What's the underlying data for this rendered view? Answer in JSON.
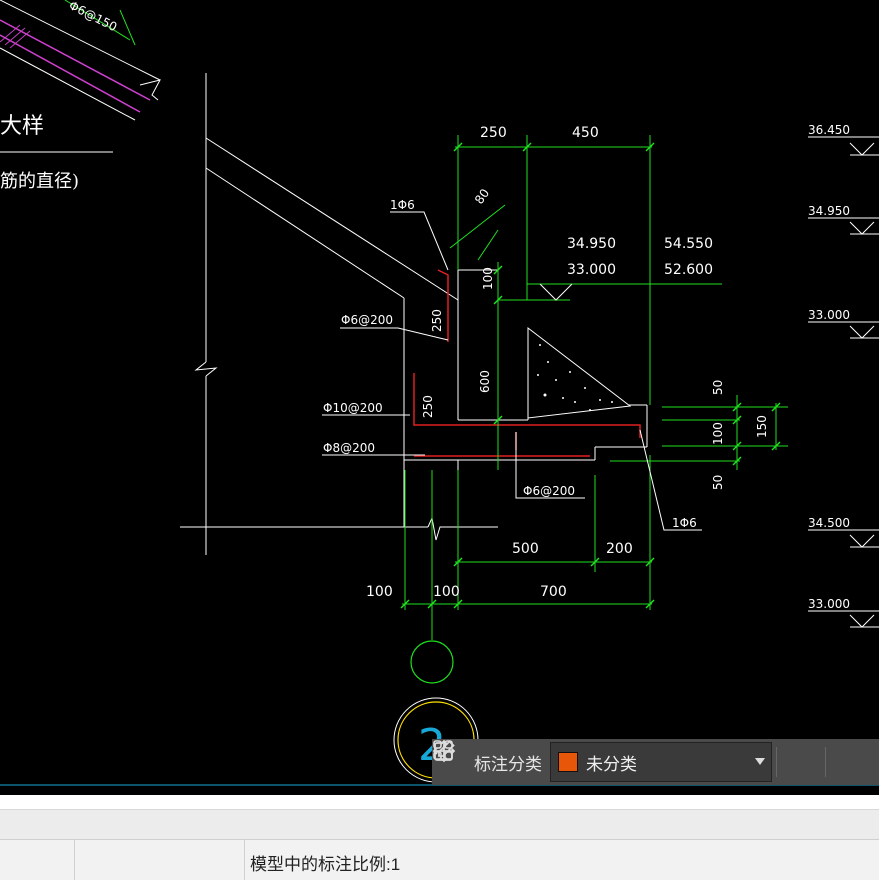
{
  "drawing": {
    "title_fragment": "大样",
    "subtitle_fragment": "筋的直径)",
    "top_rebar_label": "Φ6@150",
    "dims": {
      "top_250": "250",
      "top_450": "450",
      "angle_80": "80",
      "v_100": "100",
      "v_250a": "250",
      "v_600": "600",
      "v_250b": "250",
      "right_50a": "50",
      "right_100": "100",
      "right_150": "150",
      "right_50b": "50",
      "b_500": "500",
      "b_200": "200",
      "b_100a": "100",
      "b_100b": "100",
      "b_700": "700"
    },
    "elevations": {
      "e1a": "34.950",
      "e1b": "33.000",
      "e2a": "54.550",
      "e2b": "52.600"
    },
    "rebar_labels": {
      "r1": "1Φ6",
      "r2": "Φ6@200",
      "r3": "Φ10@200",
      "r4": "Φ8@200",
      "r5": "Φ6@200",
      "r6": "1Φ6"
    },
    "level_marks": [
      "36.450",
      "34.950",
      "33.000",
      "34.500",
      "33.000"
    ],
    "axis_bubble": "2"
  },
  "toolbar": {
    "label": "标注分类",
    "selected": "未分类",
    "swatch_color": "#e8560a"
  },
  "status": {
    "text": "模型中的标注比例:1"
  }
}
